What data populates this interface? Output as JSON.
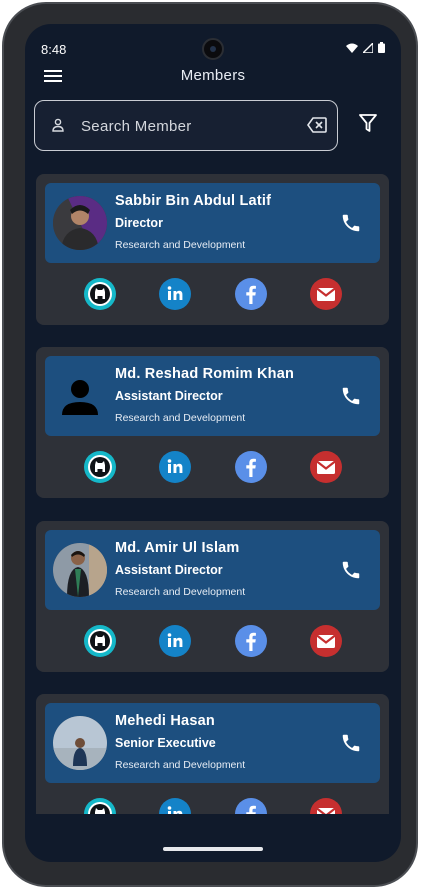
{
  "status_bar": {
    "time": "8:48"
  },
  "app_bar": {
    "title": "Members",
    "menu_icon": "hamburger-menu-icon"
  },
  "search": {
    "placeholder": "Search Member",
    "value": ""
  },
  "colors": {
    "background": "#101a2b",
    "card": "#2e3138",
    "card_header": "#1d4f7f",
    "github": "#15b8c9",
    "linkedin": "#1483c8",
    "facebook": "#5a8fe8",
    "gmail": "#c62f2f"
  },
  "members": [
    {
      "name": "Sabbir Bin Abdul Latif",
      "role": "Director",
      "department": "Research and Development",
      "avatar": "photo"
    },
    {
      "name": "Md. Reshad Romim Khan",
      "role": "Assistant Director",
      "department": "Research and Development",
      "avatar": "placeholder-person-icon"
    },
    {
      "name": "Md. Amir Ul Islam",
      "role": "Assistant Director",
      "department": "Research and Development",
      "avatar": "photo"
    },
    {
      "name": "Mehedi Hasan",
      "role": "Senior Executive",
      "department": "Research and Development",
      "avatar": "photo"
    }
  ],
  "social_links": [
    "github-icon",
    "linkedin-icon",
    "facebook-icon",
    "gmail-icon"
  ]
}
